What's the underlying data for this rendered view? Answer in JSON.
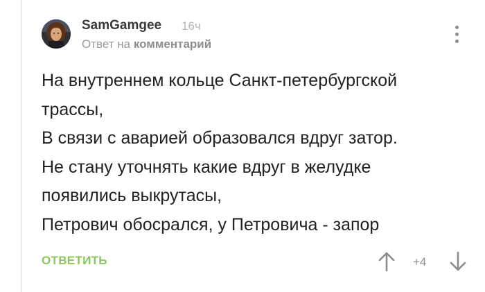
{
  "comment": {
    "author": "SamGamgee",
    "time": "16ч",
    "reply_prefix": "Ответ на",
    "reply_link": "комментарий",
    "lines": [
      "На внутреннем кольце Санкт-петербургской",
      "трассы,",
      "В связи с аварией образовался вдруг затор.",
      "Не стану уточнять какие вдруг в желудке",
      "появились выкрутасы,",
      "Петрович обосрался, у Петровича - запор"
    ],
    "reply_button": "ОТВЕТИТЬ",
    "rating": "+4"
  },
  "icons": {
    "menu": "kebab-menu-icon",
    "vote_up": "arrow-up-icon",
    "vote_down": "arrow-down-icon"
  },
  "colors": {
    "accent": "#8ac858",
    "muted": "#b5b5b5",
    "text": "#222222"
  }
}
